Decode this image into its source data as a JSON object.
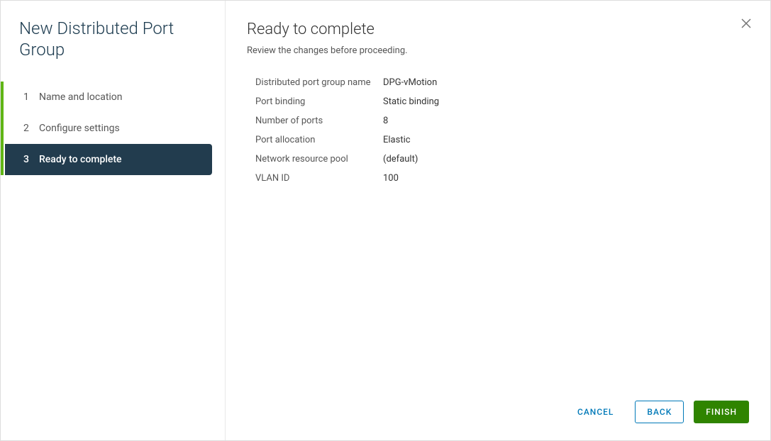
{
  "wizard": {
    "title": "New Distributed Port Group",
    "steps": [
      {
        "num": "1",
        "label": "Name and location"
      },
      {
        "num": "2",
        "label": "Configure settings"
      },
      {
        "num": "3",
        "label": "Ready to complete"
      }
    ]
  },
  "main": {
    "title": "Ready to complete",
    "subtitle": "Review the changes before proceeding.",
    "summary": [
      {
        "label": "Distributed port group name",
        "value": "DPG-vMotion"
      },
      {
        "label": "Port binding",
        "value": "Static binding"
      },
      {
        "label": "Number of ports",
        "value": "8"
      },
      {
        "label": "Port allocation",
        "value": "Elastic"
      },
      {
        "label": "Network resource pool",
        "value": "(default)"
      },
      {
        "label": "VLAN ID",
        "value": "100"
      }
    ]
  },
  "footer": {
    "cancel": "CANCEL",
    "back": "BACK",
    "finish": "FINISH"
  }
}
